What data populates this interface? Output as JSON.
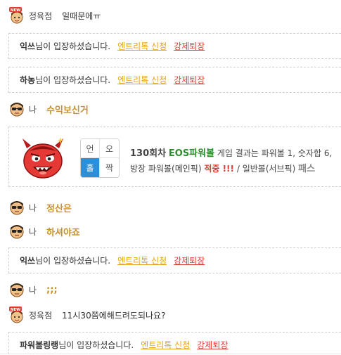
{
  "messages": [
    {
      "avatar": "new-badge-avatar-icon",
      "nickname": "정육점",
      "text": "일때문에ㅠ"
    },
    {
      "avatar": "sunglasses-avatar-icon",
      "nickname": "나",
      "text": "수익보신거"
    },
    {
      "avatar": "sunglasses-avatar-icon",
      "nickname": "나",
      "text": "정산은"
    },
    {
      "avatar": "sunglasses-avatar-icon",
      "nickname": "나",
      "text": "하셔야죠"
    },
    {
      "avatar": "sunglasses-avatar-icon",
      "nickname": "나",
      "text": ";;;"
    },
    {
      "avatar": "new-badge-avatar-icon",
      "nickname": "정육점",
      "text": "11시30쯤에해드려도되나요?"
    }
  ],
  "notices": [
    {
      "username": "익쓰",
      "rest": "님이 입장하셨습니다.",
      "entry_label": "엔트리톡 신청",
      "kick_label": "강제퇴장"
    },
    {
      "username": "하농",
      "rest": "님이 입장하셨습니다.",
      "entry_label": "엔트리톡 신청",
      "kick_label": "강제퇴장"
    },
    {
      "username": "익쓰",
      "rest": "님이 입장하셨습니다.",
      "entry_label": "엔트리톡 신청",
      "kick_label": "강제퇴장"
    },
    {
      "username": "파워볼링랭",
      "rest": "님이 입장하셨습니다.",
      "entry_label": "엔트리톡 신청",
      "kick_label": "강제퇴장"
    }
  ],
  "result": {
    "grid": {
      "top_left": "언",
      "top_right": "오",
      "bottom_left": "홀",
      "bottom_right": "짝"
    },
    "round": "130회차",
    "game_name": "EOS파워볼",
    "line1_rest": "게임 결과는 파워볼 1, 숫자합 6,",
    "line2_prefix": "방장 파워볼(메인픽)",
    "hit": "적중 !!!",
    "line2_mid": "/ 일반볼(서브픽)",
    "pass": "패스"
  },
  "colors": {
    "gold_text": "#c8902a",
    "entry_link": "#e8a317",
    "kick_link": "#e03c31",
    "game_green": "#2e8b2e",
    "highlight_blue": "#2d8fd8"
  }
}
